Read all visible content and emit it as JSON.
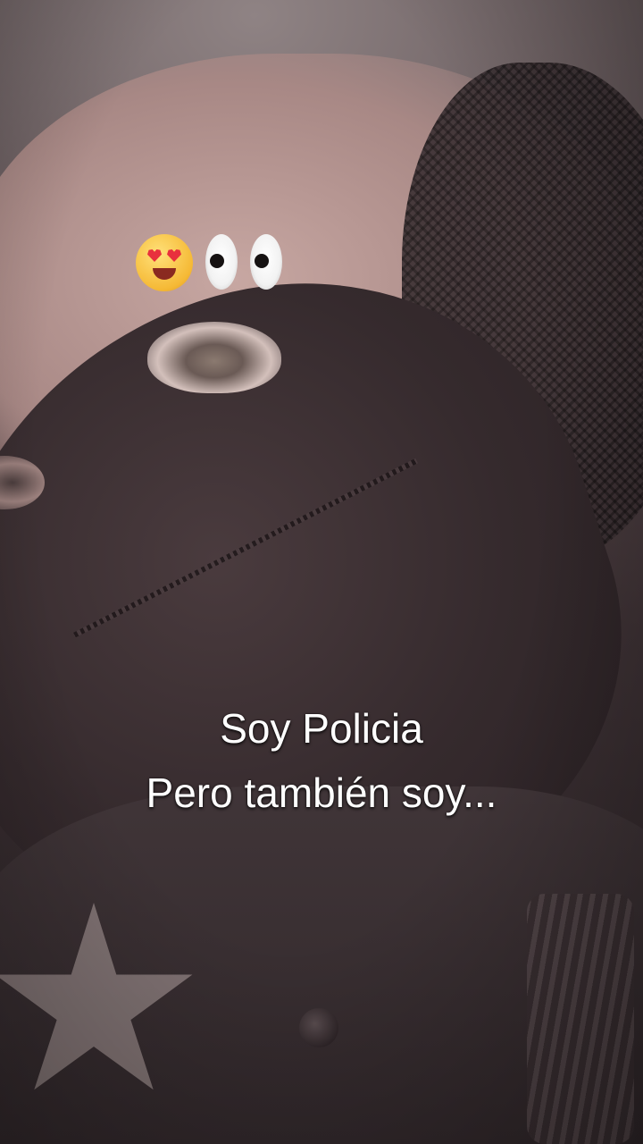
{
  "overlay": {
    "emojis": [
      "😍",
      "👀"
    ],
    "caption_lines": [
      "Soy Policia",
      "Pero también soy..."
    ]
  },
  "colors": {
    "caption_text": "#ffffff",
    "tone": "#6d5a5c"
  }
}
